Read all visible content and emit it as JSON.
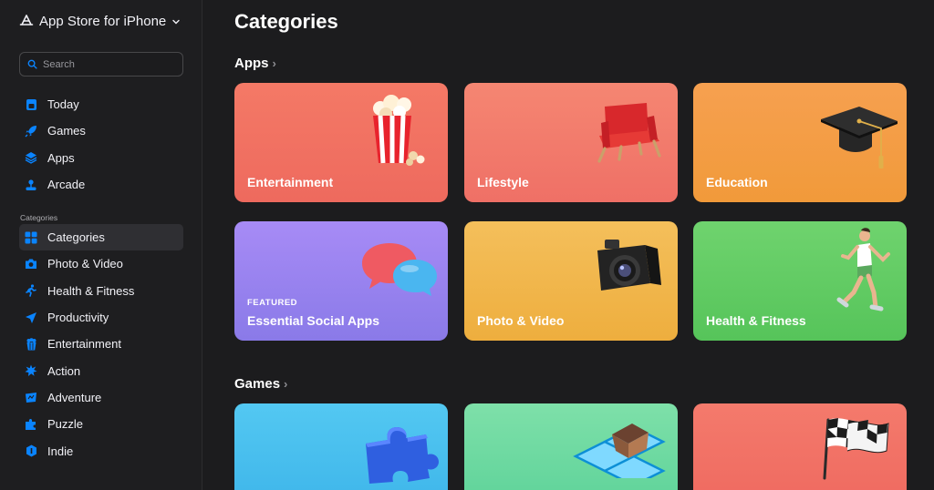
{
  "app_title": "App Store for iPhone",
  "search": {
    "placeholder": "Search"
  },
  "nav_top": [
    {
      "label": "Today",
      "icon": "today-icon"
    },
    {
      "label": "Games",
      "icon": "rocket-icon"
    },
    {
      "label": "Apps",
      "icon": "layers-icon"
    },
    {
      "label": "Arcade",
      "icon": "joystick-icon"
    }
  ],
  "categories_label": "Categories",
  "nav_categories": [
    {
      "label": "Categories",
      "icon": "grid-icon",
      "active": true
    },
    {
      "label": "Photo & Video",
      "icon": "camera-icon"
    },
    {
      "label": "Health & Fitness",
      "icon": "runner-icon"
    },
    {
      "label": "Productivity",
      "icon": "paper-plane-icon"
    },
    {
      "label": "Entertainment",
      "icon": "popcorn-icon"
    },
    {
      "label": "Action",
      "icon": "burst-icon"
    },
    {
      "label": "Adventure",
      "icon": "map-icon"
    },
    {
      "label": "Puzzle",
      "icon": "puzzle-icon"
    },
    {
      "label": "Indie",
      "icon": "indie-icon"
    }
  ],
  "main": {
    "title": "Categories",
    "apps_section": "Apps",
    "games_section": "Games",
    "app_cards": [
      {
        "label": "Entertainment"
      },
      {
        "label": "Lifestyle"
      },
      {
        "label": "Education"
      },
      {
        "label": "Essential Social Apps",
        "tag": "FEATURED"
      },
      {
        "label": "Photo & Video"
      },
      {
        "label": "Health & Fitness"
      }
    ]
  },
  "accent_color": "#0a84ff"
}
